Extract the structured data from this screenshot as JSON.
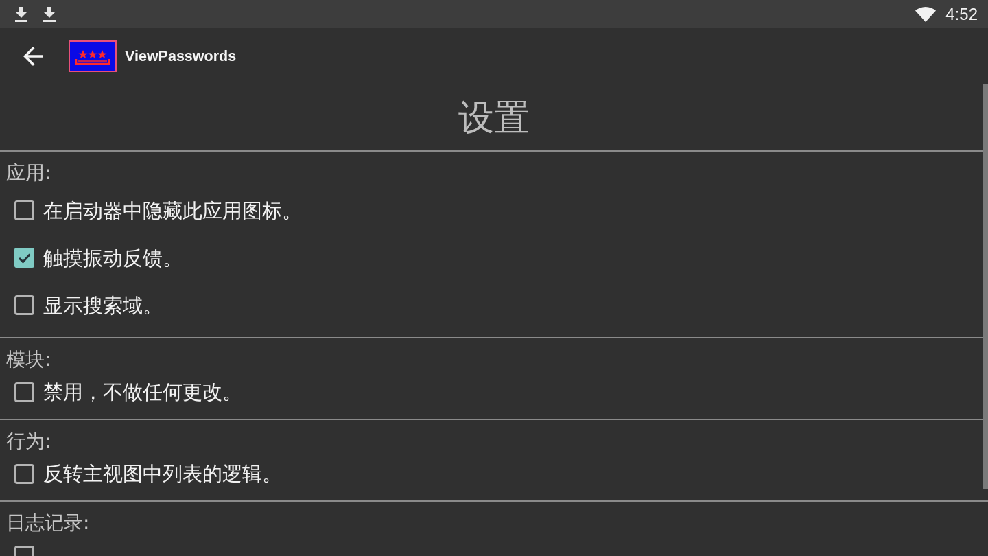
{
  "status_bar": {
    "time": "4:52"
  },
  "app_bar": {
    "title": "ViewPasswords"
  },
  "page_title": "设置",
  "sections": [
    {
      "header": "应用:",
      "items": [
        {
          "label": "在启动器中隐藏此应用图标。",
          "checked": false
        },
        {
          "label": "触摸振动反馈。",
          "checked": true
        },
        {
          "label": "显示搜索域。",
          "checked": false
        }
      ]
    },
    {
      "header": "模块:",
      "items": [
        {
          "label": "禁用，不做任何更改。",
          "checked": false
        }
      ]
    },
    {
      "header": "行为:",
      "items": [
        {
          "label": "反转主视图中列表的逻辑。",
          "checked": false
        }
      ]
    },
    {
      "header": "日志记录:",
      "items": [
        {
          "checked": false
        }
      ]
    }
  ]
}
